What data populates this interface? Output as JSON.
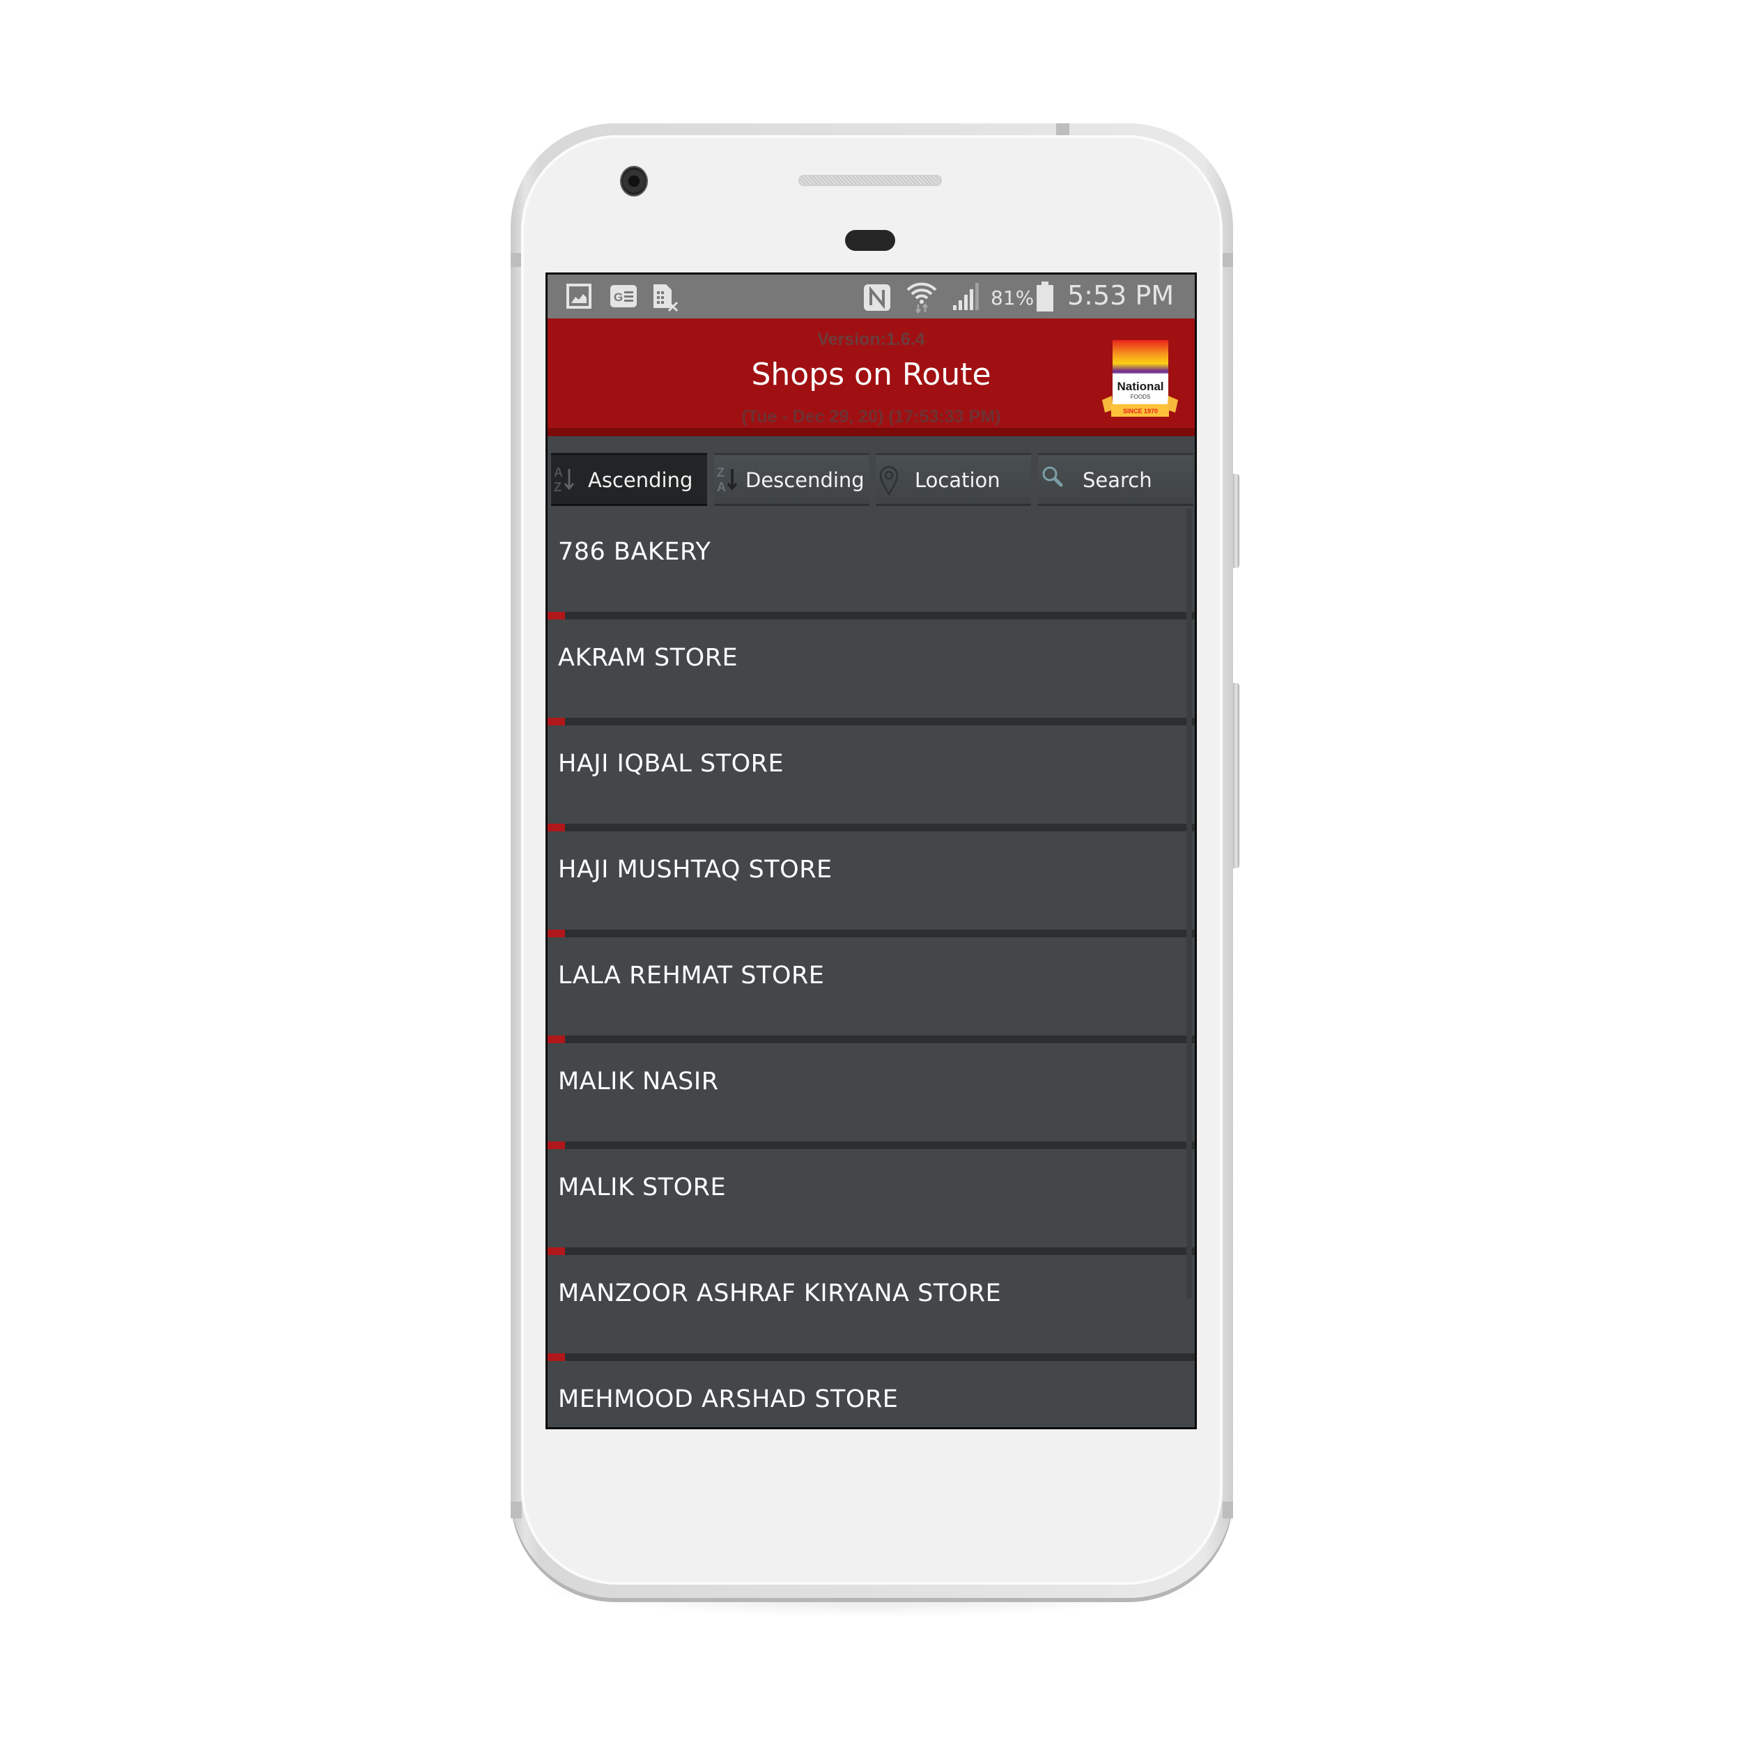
{
  "status_bar": {
    "left_icons": [
      "gallery-icon",
      "google-news-icon",
      "sim-off-icon"
    ],
    "right_icons": [
      "nfc-icon",
      "wifi-icon",
      "signal-icon",
      "battery-icon"
    ],
    "battery_percent": "81%",
    "time": "5:53 PM"
  },
  "header": {
    "version": "Version:1.6.4",
    "title": "Shops on Route",
    "datetime": "(Tue - Dec 29, 20) (17:53:33 PM)",
    "logo": {
      "name": "National",
      "sub": "FOODS",
      "tagline": "SINCE 1970"
    }
  },
  "toolbar": {
    "buttons": [
      {
        "label": "Ascending",
        "icon": "sort-az-icon",
        "glyph": "A\nZ",
        "active": true
      },
      {
        "label": "Descending",
        "icon": "sort-za-icon",
        "glyph": "Z\nA",
        "active": false
      },
      {
        "label": "Location",
        "icon": "map-pin-icon",
        "glyph": "",
        "active": false
      },
      {
        "label": "Search",
        "icon": "search-icon",
        "glyph": "",
        "active": false
      }
    ]
  },
  "shops": [
    "786 BAKERY",
    "AKRAM STORE",
    "HAJI IQBAL STORE",
    "HAJI MUSHTAQ STORE",
    "LALA REHMAT STORE",
    "MALIK NASIR",
    "MALIK STORE",
    "MANZOOR ASHRAF KIRYANA STORE",
    "MEHMOOD ARSHAD STORE"
  ],
  "colors": {
    "header_red": "#a01012",
    "accent_red": "#b0171a",
    "list_bg": "#434749",
    "status_bar": "#787878"
  }
}
